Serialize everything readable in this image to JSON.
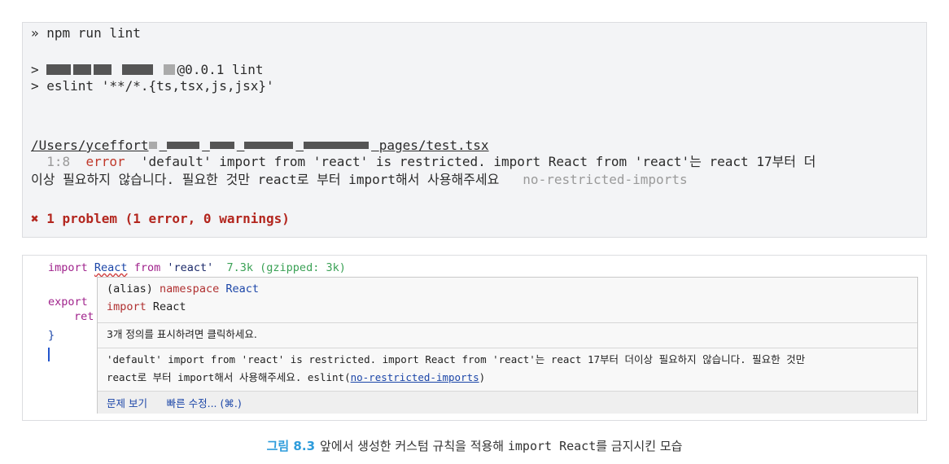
{
  "terminal": {
    "command_line": "» npm run lint",
    "pkg_suffix": "@0.0.1 lint",
    "eslint_cmd": "> eslint '**/*.{ts,tsx,js,jsx}'",
    "path_prefix": "/Users/yceffort",
    "path_suffix": "pages/test.tsx",
    "error_location": "1:8",
    "error_label": "error",
    "error_message_1": "'default' import from 'react' is restricted. import React from 'react'는 react 17부터 더",
    "error_message_2": "이상 필요하지 않습니다. 필요한 것만 react로 부터 import해서 사용해주세요",
    "rule_name": "no-restricted-imports",
    "problem_summary": "✖ 1 problem (1 error, 0 warnings)"
  },
  "editor": {
    "line1_import": "import",
    "line1_ident": "React",
    "line1_from": "from",
    "line1_module": "'react'",
    "line1_size": "7.3k (gzipped: 3k)",
    "line2_partial": "export",
    "line3_partial": "ret",
    "line4_partial": "}"
  },
  "hover": {
    "alias_prefix": "(alias)",
    "alias_kind": "namespace",
    "alias_name": "React",
    "import_kw": "import",
    "import_name": "React",
    "definition_hint": "3개 정의를 표시하려면 클릭하세요.",
    "lint_message_1": "'default' import from 'react' is restricted. import React from 'react'는 react 17부터 더이상 필요하지 않습니다. 필요한 것만",
    "lint_message_2": "react로 부터 import해서 사용해주세요. eslint(",
    "lint_rule_link": "no-restricted-imports",
    "lint_message_end": ")",
    "action_view_problem": "문제 보기",
    "action_quick_fix": "빠른 수정... (⌘.)"
  },
  "caption": {
    "figure_label": "그림 8.3",
    "text_before": "앞에서 생성한 커스텀 규칙을 적용해 ",
    "text_code": "import React",
    "text_after": "를 금지시킨 모습"
  },
  "colors": {
    "figure_label": "#2e9cdb",
    "error_red": "#c0392b",
    "link_blue": "#1c46a8"
  }
}
